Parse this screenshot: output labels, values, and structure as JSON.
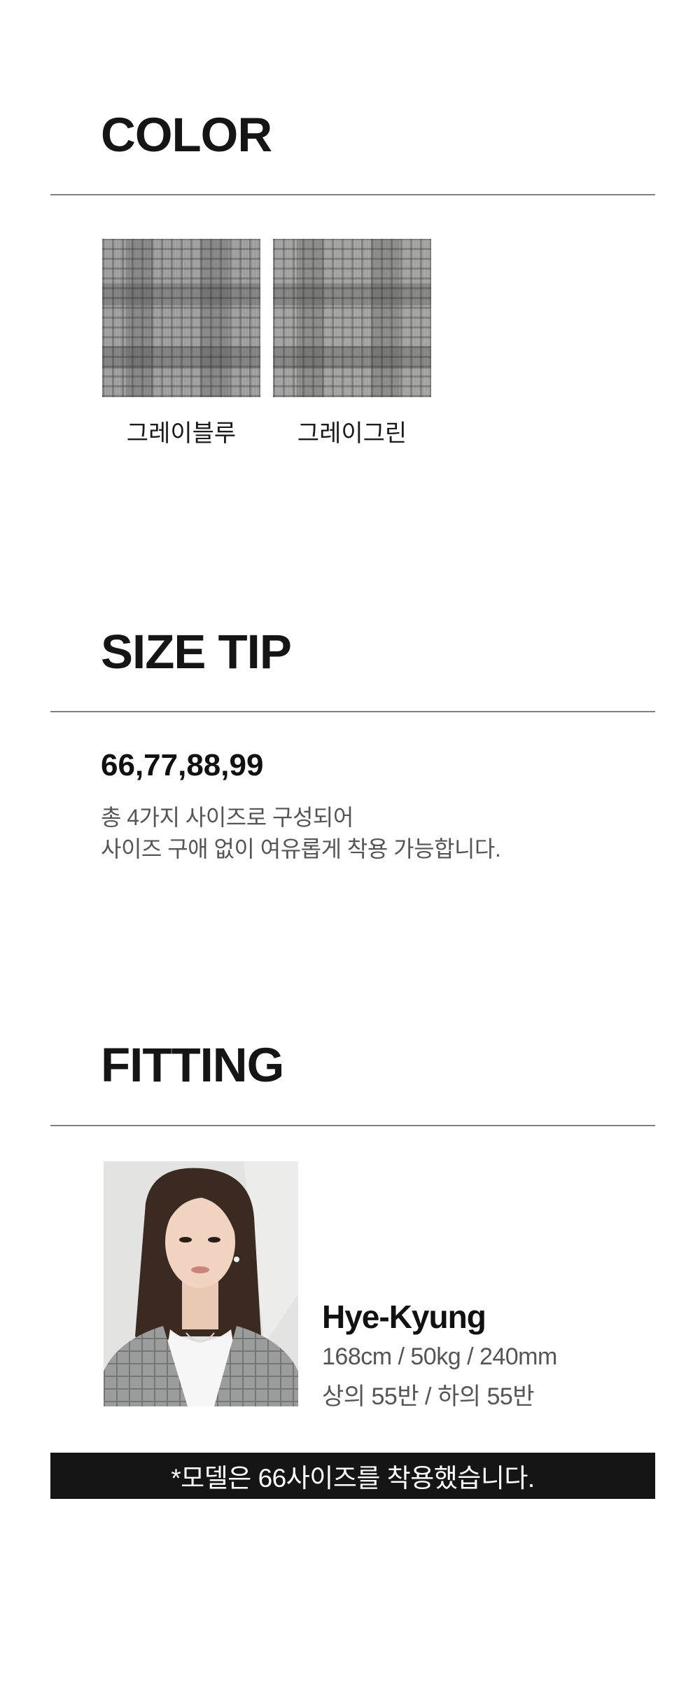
{
  "color_section": {
    "heading": "COLOR",
    "swatches": [
      {
        "label": "그레이블루",
        "color": "#9d9d9d"
      },
      {
        "label": "그레이그린",
        "color": "#a2a3a0"
      }
    ]
  },
  "size_section": {
    "heading": "SIZE TIP",
    "sizes": "66,77,88,99",
    "desc_line1": "총 4가지 사이즈로 구성되어",
    "desc_line2": "사이즈 구애 없이 여유롭게 착용 가능합니다."
  },
  "fitting_section": {
    "heading": "FITTING",
    "model_name": "Hye-Kyung",
    "model_stats": "168cm / 50kg / 240mm",
    "model_sizes": "상의 55반 / 하의 55반"
  },
  "notice": {
    "text": "*모델은 66사이즈를 착용했습니다.",
    "background": "#151515"
  }
}
